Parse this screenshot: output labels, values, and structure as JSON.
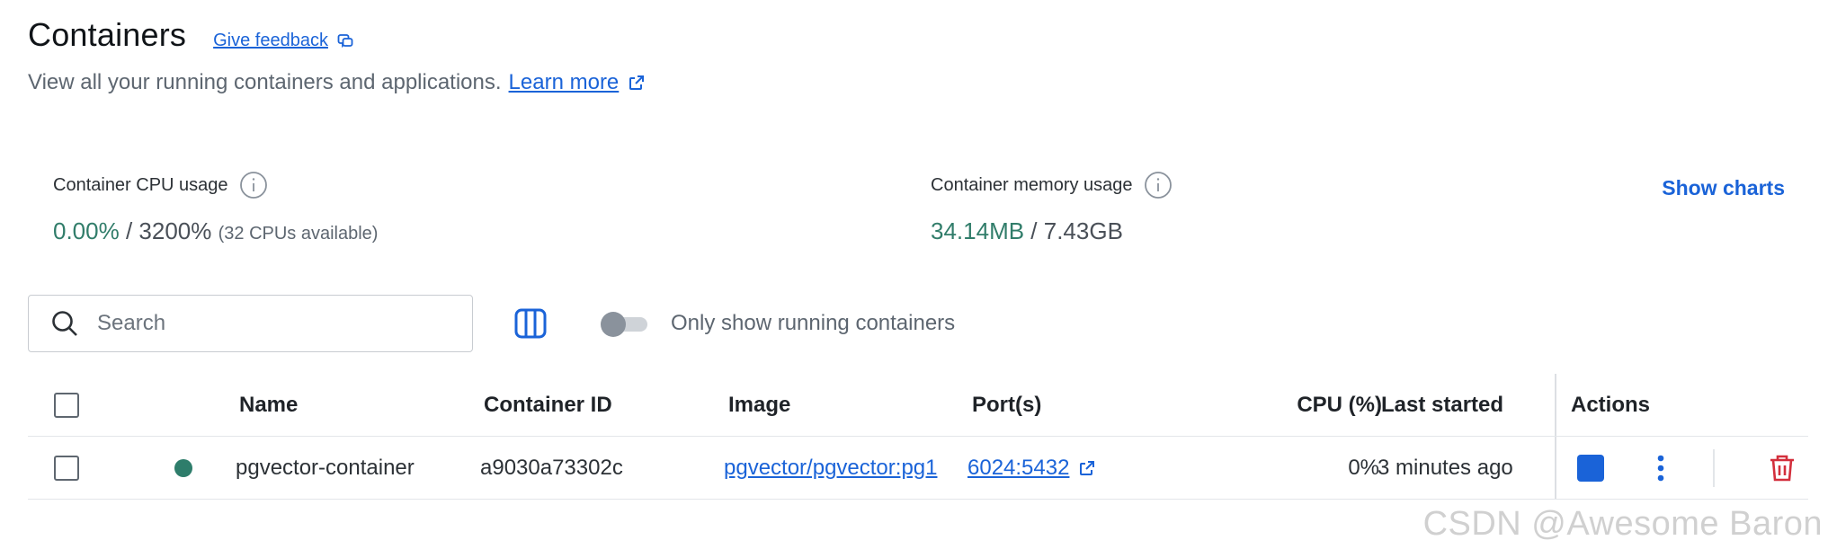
{
  "header": {
    "title": "Containers",
    "feedback_label": "Give feedback",
    "subtitle": "View all your running containers and applications.",
    "learn_more_label": "Learn more"
  },
  "stats": {
    "cpu": {
      "label": "Container CPU usage",
      "used": "0.00%",
      "separator": " / ",
      "total": "3200%",
      "note": "(32 CPUs available)"
    },
    "memory": {
      "label": "Container memory usage",
      "used": "34.14MB",
      "separator": " / ",
      "total": "7.43GB"
    },
    "show_charts_label": "Show charts"
  },
  "toolbar": {
    "search_placeholder": "Search",
    "search_value": "",
    "running_only_label": "Only show running containers",
    "running_only_enabled": false
  },
  "table": {
    "headers": {
      "name": "Name",
      "container_id": "Container ID",
      "image": "Image",
      "ports": "Port(s)",
      "cpu": "CPU (%)",
      "last_started": "Last started",
      "actions": "Actions"
    },
    "rows": [
      {
        "status": "running",
        "name": "pgvector-container",
        "container_id": "a9030a73302c",
        "image": "pgvector/pgvector:pg1",
        "ports": "6024:5432",
        "cpu": "0%",
        "last_started": "3 minutes ago"
      }
    ]
  },
  "watermark": "CSDN @Awesome Baron",
  "colors": {
    "accent": "#1a63d8",
    "running_green": "#2e7d6b",
    "stat_green": "#317d6a",
    "delete_red": "#d32f3c"
  },
  "icons": {
    "feedback": "feedback-icon",
    "external_link": "external-link-icon",
    "info": "info-icon",
    "search": "search-icon",
    "columns": "columns-icon",
    "stop": "stop-icon",
    "more": "more-vertical-icon",
    "delete": "trash-icon"
  }
}
